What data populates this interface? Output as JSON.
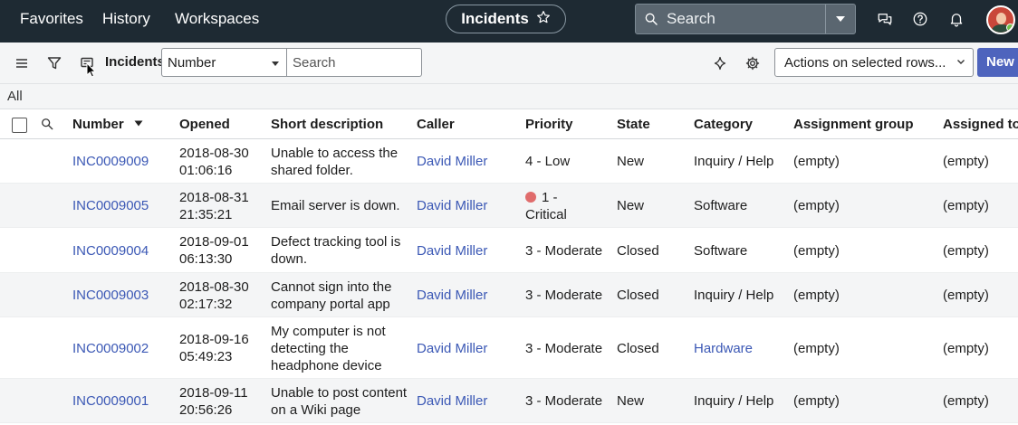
{
  "nav": {
    "favorites": "Favorites",
    "history": "History",
    "workspaces": "Workspaces"
  },
  "app": {
    "title": "Incidents"
  },
  "search": {
    "placeholder": "Search"
  },
  "toolbar": {
    "list_title": "Incidents",
    "field_selected": "Number",
    "search_placeholder": "Search",
    "actions_selected": "Actions on selected rows...",
    "new_label": "New"
  },
  "breadcrumb": {
    "label": "All"
  },
  "columns": {
    "number": "Number",
    "opened": "Opened",
    "short_description": "Short description",
    "caller": "Caller",
    "priority": "Priority",
    "state": "State",
    "category": "Category",
    "assignment_group": "Assignment group",
    "assigned_to": "Assigned to"
  },
  "rows": [
    {
      "number": "INC0009009",
      "opened": [
        "2018-08-30",
        "01:06:16"
      ],
      "desc": [
        "Unable to access the",
        "shared folder."
      ],
      "caller": "David Miller",
      "priority": [
        "4 - Low"
      ],
      "critical": false,
      "state": "New",
      "category": "Inquiry / Help",
      "category_link": false,
      "group": "(empty)",
      "assigned": "(empty)"
    },
    {
      "number": "INC0009005",
      "opened": [
        "2018-08-31",
        "21:35:21"
      ],
      "desc": [
        "Email server is down."
      ],
      "caller": "David Miller",
      "priority": [
        "1 -",
        "Critical"
      ],
      "critical": true,
      "state": "New",
      "category": "Software",
      "category_link": false,
      "group": "(empty)",
      "assigned": "(empty)"
    },
    {
      "number": "INC0009004",
      "opened": [
        "2018-09-01",
        "06:13:30"
      ],
      "desc": [
        "Defect tracking tool is",
        "down."
      ],
      "caller": "David Miller",
      "priority": [
        "3 - Moderate"
      ],
      "critical": false,
      "state": "Closed",
      "category": "Software",
      "category_link": false,
      "group": "(empty)",
      "assigned": "(empty)"
    },
    {
      "number": "INC0009003",
      "opened": [
        "2018-08-30",
        "02:17:32"
      ],
      "desc": [
        "Cannot sign into the",
        "company portal app"
      ],
      "caller": "David Miller",
      "priority": [
        "3 - Moderate"
      ],
      "critical": false,
      "state": "Closed",
      "category": "Inquiry / Help",
      "category_link": false,
      "group": "(empty)",
      "assigned": "(empty)"
    },
    {
      "number": "INC0009002",
      "opened": [
        "2018-09-16",
        "05:49:23"
      ],
      "desc": [
        "My computer is not",
        "detecting the",
        "headphone device"
      ],
      "caller": "David Miller",
      "priority": [
        "3 - Moderate"
      ],
      "critical": false,
      "state": "Closed",
      "category": "Hardware",
      "category_link": true,
      "group": "(empty)",
      "assigned": "(empty)"
    },
    {
      "number": "INC0009001",
      "opened": [
        "2018-09-11",
        "20:56:26"
      ],
      "desc": [
        "Unable to post content",
        "on a Wiki page"
      ],
      "caller": "David Miller",
      "priority": [
        "3 - Moderate"
      ],
      "critical": false,
      "state": "New",
      "category": "Inquiry / Help",
      "category_link": false,
      "group": "(empty)",
      "assigned": "(empty)"
    }
  ],
  "colors": {
    "nav_bg": "#1e2a33",
    "link": "#3b58b5",
    "primary": "#4e64bd",
    "critical": "#e06c6c",
    "stripe": "#f4f5f6"
  },
  "icons": {
    "toolbar": [
      "menu-icon",
      "filter-icon",
      "list-context-icon",
      "sparkle-icon",
      "gear-icon"
    ],
    "nav": [
      "chat-icon",
      "help-icon",
      "bell-icon",
      "star-icon",
      "search-icon"
    ]
  }
}
